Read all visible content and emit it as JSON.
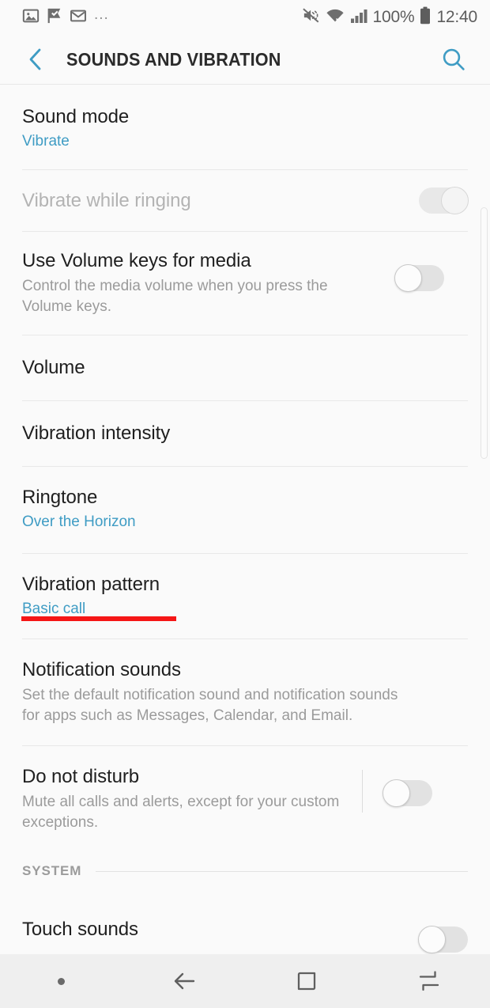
{
  "status_bar": {
    "left_icons": [
      "image-icon",
      "flag-check-icon",
      "email-icon"
    ],
    "overflow": "...",
    "right_icons": [
      "mute-vibrate-icon",
      "wifi-icon",
      "signal-bars-icon",
      "battery-icon"
    ],
    "battery_percent": "100%",
    "clock": "12:40"
  },
  "app_bar": {
    "back_label": "back",
    "title": "SOUNDS AND VIBRATION",
    "search_label": "search"
  },
  "colors": {
    "accent": "#3f9cc4",
    "annotation_red": "#f51616",
    "background": "#fafafa",
    "title_text": "#1f1f1f",
    "secondary_text": "#9b9b9b",
    "disabled_text": "#b3b3b3",
    "nav_bar": "#efefef"
  },
  "rows": [
    {
      "name": "sound-mode",
      "title": "Sound mode",
      "value": "Vibrate",
      "value_style": "accent",
      "disabled": false,
      "toggle": null
    },
    {
      "name": "vibrate-while-ringing",
      "title": "Vibrate while ringing",
      "value": null,
      "value_style": null,
      "disabled": true,
      "toggle": {
        "state": "on",
        "disabled": true
      }
    },
    {
      "name": "use-volume-keys-for-media",
      "title": "Use Volume keys for media",
      "value": "Control the media volume when you press the Volume keys.",
      "value_style": "secondary",
      "disabled": false,
      "toggle": {
        "state": "off",
        "disabled": false
      }
    },
    {
      "name": "volume",
      "title": "Volume",
      "value": null,
      "value_style": null,
      "disabled": false,
      "toggle": null
    },
    {
      "name": "vibration-intensity",
      "title": "Vibration intensity",
      "value": null,
      "value_style": null,
      "disabled": false,
      "toggle": null
    },
    {
      "name": "ringtone",
      "title": "Ringtone",
      "value": "Over the Horizon",
      "value_style": "accent",
      "disabled": false,
      "toggle": null,
      "annotated": true
    },
    {
      "name": "vibration-pattern",
      "title": "Vibration pattern",
      "value": "Basic call",
      "value_style": "accent",
      "disabled": false,
      "toggle": null
    },
    {
      "name": "notification-sounds",
      "title": "Notification sounds",
      "value": "Set the default notification sound and notification sounds for apps such as Messages, Calendar, and Email.",
      "value_style": "secondary",
      "disabled": false,
      "toggle": null
    },
    {
      "name": "do-not-disturb",
      "title": "Do not disturb",
      "value": "Mute all calls and alerts, except for your custom exceptions.",
      "value_style": "secondary",
      "disabled": false,
      "toggle": {
        "state": "off",
        "disabled": false,
        "separator": true
      }
    }
  ],
  "section": {
    "label": "SYSTEM"
  },
  "partial_row": {
    "name": "touch-sounds",
    "title": "Touch sounds",
    "toggle": {
      "state": "off",
      "disabled": false
    }
  },
  "nav_bar": {
    "items": [
      "dot-indicator",
      "back-nav-icon",
      "home-nav-icon",
      "recents-nav-icon"
    ]
  }
}
